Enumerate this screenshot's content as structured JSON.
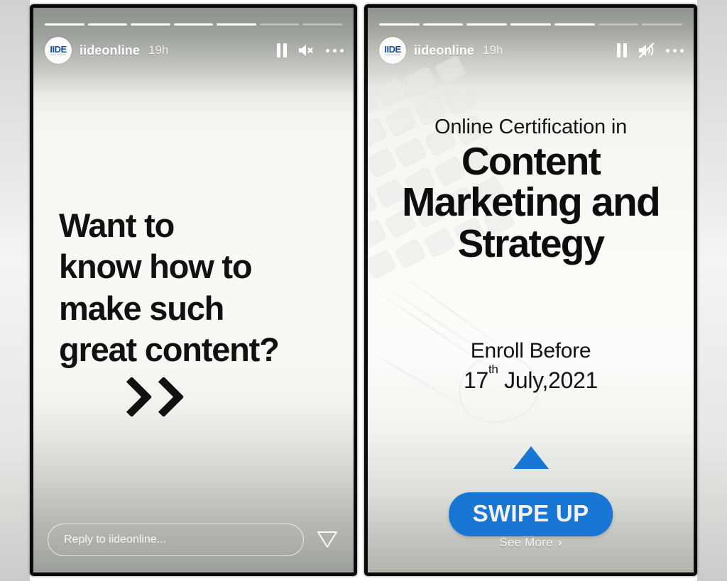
{
  "app": {
    "name": "Instagram Stories",
    "view": "two story frames side by side"
  },
  "colors": {
    "accent_blue": "#1877D4",
    "story_text": "#111111",
    "header_text": "#FFFFFF",
    "frame_border": "#0B0B0B"
  },
  "stories": [
    {
      "id": "story-left",
      "progress": {
        "total": 7,
        "completed": 5
      },
      "header": {
        "avatar_label": "IIDE",
        "avatar_sublabel": "digital marketing",
        "username": "iideonline",
        "timestamp": "19h",
        "actions": [
          {
            "name": "pause-icon",
            "label": "Pause"
          },
          {
            "name": "sound-off-icon",
            "label": "Sound off"
          },
          {
            "name": "more-options-icon",
            "label": "More options"
          }
        ]
      },
      "body": {
        "headline_lines": [
          "Want to",
          "know how to",
          "make such",
          "great content?"
        ],
        "chevron": "double-chevron-right"
      },
      "footer": {
        "reply_placeholder": "Reply to iideonline...",
        "reply_value": "",
        "send_icon_label": "Send message"
      }
    },
    {
      "id": "story-right",
      "progress": {
        "total": 7,
        "completed": 5
      },
      "header": {
        "avatar_label": "IIDE",
        "avatar_sublabel": "digital marketing",
        "username": "iideonline",
        "timestamp": "19h",
        "actions": [
          {
            "name": "pause-icon",
            "label": "Pause"
          },
          {
            "name": "mute-icon",
            "label": "Muted"
          },
          {
            "name": "more-options-icon",
            "label": "More options"
          }
        ]
      },
      "body": {
        "kicker": "Online Certification in",
        "title_line1": "Content",
        "title_line2": "Marketing and",
        "title_line3": "Strategy",
        "enroll_label": "Enroll Before",
        "enroll_day": "17",
        "enroll_ordinal": "th",
        "enroll_rest": " July,2021"
      },
      "cta": {
        "arrow_icon": "triangle-up-icon",
        "button_label": "SWIPE UP",
        "see_more_label": "See More",
        "see_more_caret": "›"
      }
    }
  ]
}
